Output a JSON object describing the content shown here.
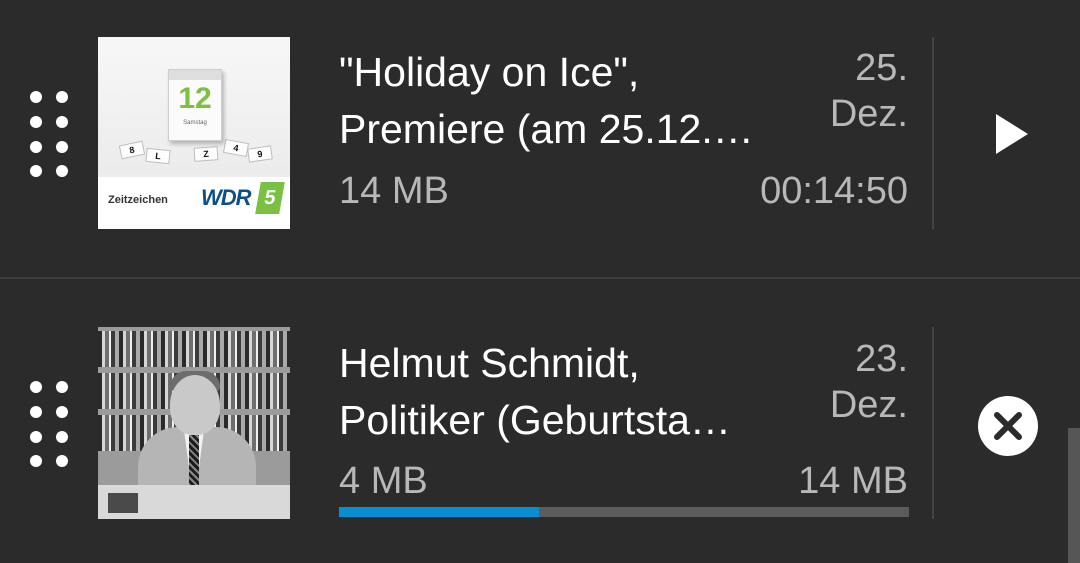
{
  "episodes": [
    {
      "title": "\"Holiday on Ice\",\nPremiere (am 25.12.…",
      "date": "25.\nDez.",
      "size": "14 MB",
      "duration": "00:14:50",
      "thumbnail": {
        "label": "Zeitzeichen",
        "brand": "WDR",
        "brand_number": "5",
        "calendar_number": "12",
        "calendar_weekday": "Samstag"
      },
      "action_icon": "play-icon"
    },
    {
      "title": "Helmut Schmidt,\nPolitiker (Geburtsta…",
      "date": "23.\nDez.",
      "downloaded": "4 MB",
      "total_size": "14 MB",
      "download_progress": 0.35,
      "action_icon": "cancel-icon"
    }
  ],
  "colors": {
    "background": "#2b2b2b",
    "progress": "#0b8ed1",
    "progress_track": "#5c5c5c",
    "primary_text": "#ffffff",
    "secondary_text": "#b8b8b8"
  }
}
